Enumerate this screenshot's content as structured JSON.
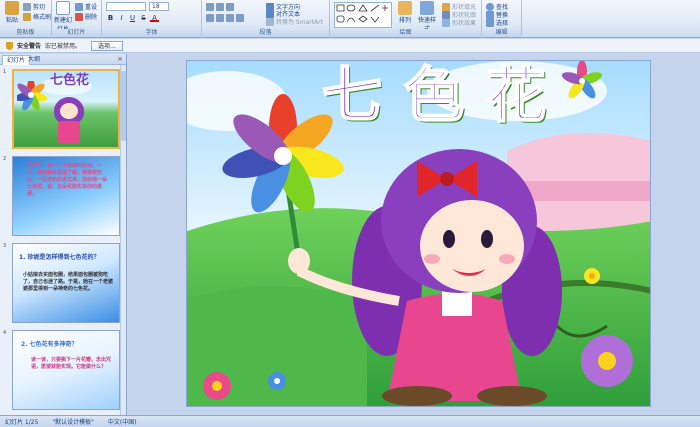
{
  "ribbon": {
    "clipboard": {
      "paste": "粘贴",
      "cut": "剪切",
      "copy": "复制",
      "format_painter": "格式刷",
      "label": "剪贴板"
    },
    "slides": {
      "new_slide": "新建幻灯片",
      "layout": "版式",
      "reset": "重设",
      "delete": "删除",
      "label": "幻灯片"
    },
    "font": {
      "font_size": "18",
      "label": "字体"
    },
    "paragraph": {
      "text_direction": "文字方向",
      "align_text": "对齐文本",
      "convert_smartart": "转换为 SmartArt",
      "label": "段落"
    },
    "drawing": {
      "arrange": "排列",
      "quick_styles": "快速样式",
      "shape_fill": "形状填充",
      "shape_outline": "形状轮廓",
      "shape_effects": "形状效果",
      "label": "绘图"
    },
    "editing": {
      "find": "查找",
      "replace": "替换",
      "select": "选择",
      "label": "编辑"
    }
  },
  "security_bar": {
    "warning": "安全警告",
    "message": "宏已被禁用。",
    "options_button": "选项..."
  },
  "left_panel": {
    "tabs": [
      "幻灯片",
      "大纲"
    ],
    "close": "×",
    "slides": [
      {
        "number": "1",
        "title": "七色花"
      },
      {
        "number": "2",
        "text": "同学们，有一个小姑娘叫珍妮。一天，她在森林里迷了路，哭得很伤心。一位老奶奶走过来，送给她一朵七色花，说：这朵花能实现你的愿望。"
      },
      {
        "number": "3",
        "heading": "1. 珍妮是怎样得到七色花的？",
        "text": "小姑娘去买面包圈，结果面包圈被狗吃了，自己也迷了路。于是，她在一个老婆婆那里得到一朵神奇的七色花。"
      },
      {
        "number": "4",
        "heading": "2. 七色花有多神奇？",
        "text": "读一读，只要撕下一片花瓣，念出咒语，愿望就能实现。它能做什么？"
      }
    ]
  },
  "slide": {
    "title": "七色花"
  },
  "status_bar": {
    "slide_count": "幻灯片 1/25",
    "theme": "\"默认设计模板\"",
    "language": "中文(中国)"
  },
  "colors": {
    "accent": "#15428b",
    "selected_border": "#f2b33d"
  }
}
